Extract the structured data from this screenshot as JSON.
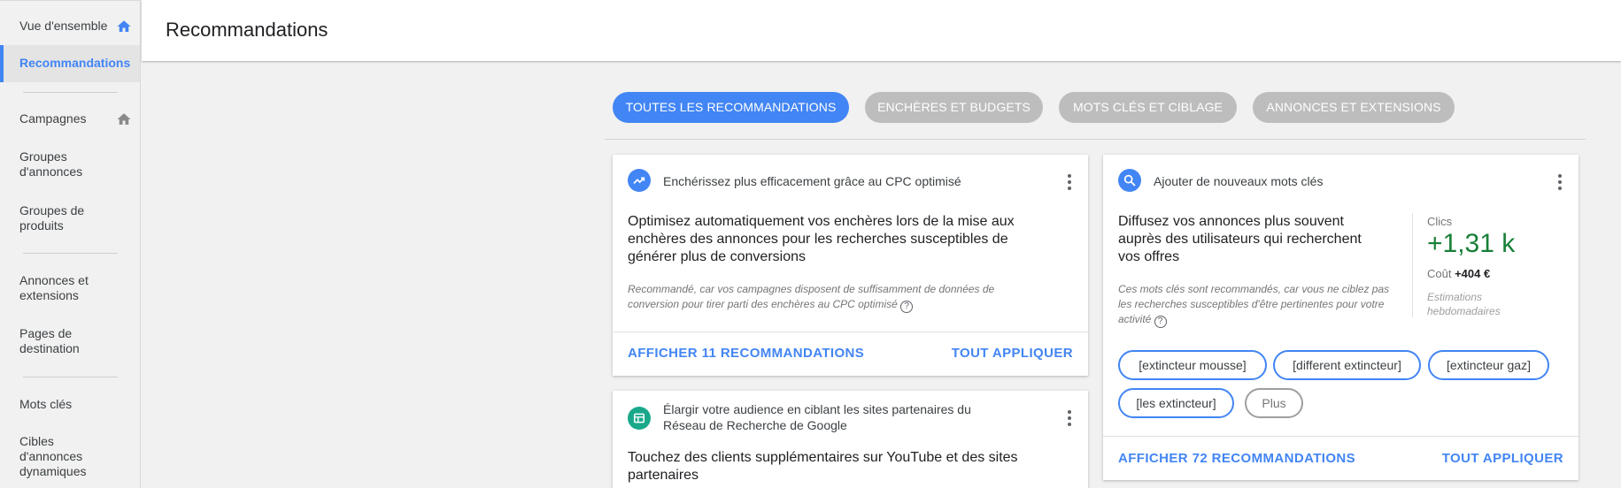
{
  "sidebar": {
    "items": [
      {
        "label": "Vue d'ensemble"
      },
      {
        "label": "Recommandations"
      },
      {
        "label": "Campagnes"
      },
      {
        "label": "Groupes d'annonces"
      },
      {
        "label": "Groupes de produits"
      },
      {
        "label": "Annonces et extensions"
      },
      {
        "label": "Pages de destination"
      },
      {
        "label": "Mots clés"
      },
      {
        "label": "Cibles d'annonces dynamiques"
      }
    ]
  },
  "header": {
    "title": "Recommandations"
  },
  "filters": [
    {
      "label": "TOUTES LES RECOMMANDATIONS"
    },
    {
      "label": "ENCHÈRES ET BUDGETS"
    },
    {
      "label": "MOTS CLÉS ET CIBLAGE"
    },
    {
      "label": "ANNONCES ET EXTENSIONS"
    }
  ],
  "cards": {
    "cpc": {
      "heading": "Enchérissez plus efficacement grâce au CPC optimisé",
      "title": "Optimisez automatiquement vos enchères lors de la mise aux enchères des annonces pour les recherches susceptibles de générer plus de conversions",
      "note": "Recommandé, car vos campagnes disposent de suffisamment de données de conversion pour tirer parti des enchères au CPC optimisé",
      "view_all": "AFFICHER 11 RECOMMANDATIONS",
      "apply_all": "TOUT APPLIQUER"
    },
    "keywords": {
      "heading": "Ajouter de nouveaux mots clés",
      "title": "Diffusez vos annonces plus souvent auprès des utilisateurs qui recherchent vos offres",
      "note": "Ces mots clés sont recommandés, car vous ne ciblez pas les recherches susceptibles d'être pertinentes pour votre activité",
      "clicks_label": "Clics",
      "clicks_value": "+1,31 k",
      "cost_label": "Coût",
      "cost_value": "+404 €",
      "estimate_note": "Estimations hebdomadaires",
      "chips": [
        "[extincteur mousse]",
        "[different extincteur]",
        "[extincteur gaz]",
        "[les extincteur]"
      ],
      "more_label": "Plus",
      "view_all": "AFFICHER 72 RECOMMANDATIONS",
      "apply_all": "TOUT APPLIQUER"
    },
    "partners": {
      "heading": "Élargir votre audience en ciblant les sites partenaires du Réseau de Recherche de Google",
      "title": "Touchez des clients supplémentaires sur YouTube et des sites partenaires"
    }
  },
  "colors": {
    "accent": "#4285f4",
    "positive": "#188038",
    "chip_inactive": "#bdbdbd",
    "partner_icon": "#1aa88b"
  }
}
